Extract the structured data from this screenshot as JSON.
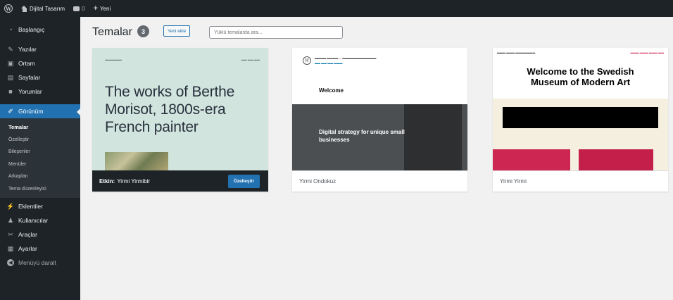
{
  "adminbar": {
    "site_name": "Dijital Tasarım",
    "comments_count": "0",
    "new_label": "Yeni"
  },
  "sidebar": {
    "items": [
      {
        "label": "Başlangıç",
        "icon": "dashboard-icon"
      },
      {
        "label": "Yazılar",
        "icon": "pin-icon"
      },
      {
        "label": "Ortam",
        "icon": "media-icon"
      },
      {
        "label": "Sayfalar",
        "icon": "page-icon"
      },
      {
        "label": "Yorumlar",
        "icon": "comment-icon"
      },
      {
        "label": "Görünüm",
        "icon": "brush-icon",
        "active": true
      },
      {
        "label": "Eklentiler",
        "icon": "plugin-icon"
      },
      {
        "label": "Kullanıcılar",
        "icon": "users-icon"
      },
      {
        "label": "Araçlar",
        "icon": "tools-icon"
      },
      {
        "label": "Ayarlar",
        "icon": "settings-icon"
      },
      {
        "label": "Menüyü daralt",
        "icon": "collapse-icon"
      }
    ],
    "submenu": [
      "Temalar",
      "Özelleştir",
      "Bileşenler",
      "Menüler",
      "Arkaplan",
      "Tema düzenleyici"
    ]
  },
  "header": {
    "title": "Temalar",
    "count": "3",
    "add_new_label": "Yeni ekle",
    "search_placeholder": "Yüklü temalarda ara..."
  },
  "themes": [
    {
      "name": "Yirmi Yirmibir",
      "active_prefix": "Etkin:",
      "customize_label": "Özelleştir",
      "headline": "The works of Berthe Morisot, 1800s-era French painter"
    },
    {
      "name": "Yirmi Ondokuz",
      "welcome": "Welcome",
      "strategy": "Digital strategy for unique small businesses"
    },
    {
      "name": "Yirmi Yirmi",
      "headline": "Welcome to the Swedish Museum of Modern Art"
    }
  ],
  "colors": {
    "admin_dark": "#1d2327",
    "accent": "#2271b1",
    "background": "#f1f1f1"
  }
}
